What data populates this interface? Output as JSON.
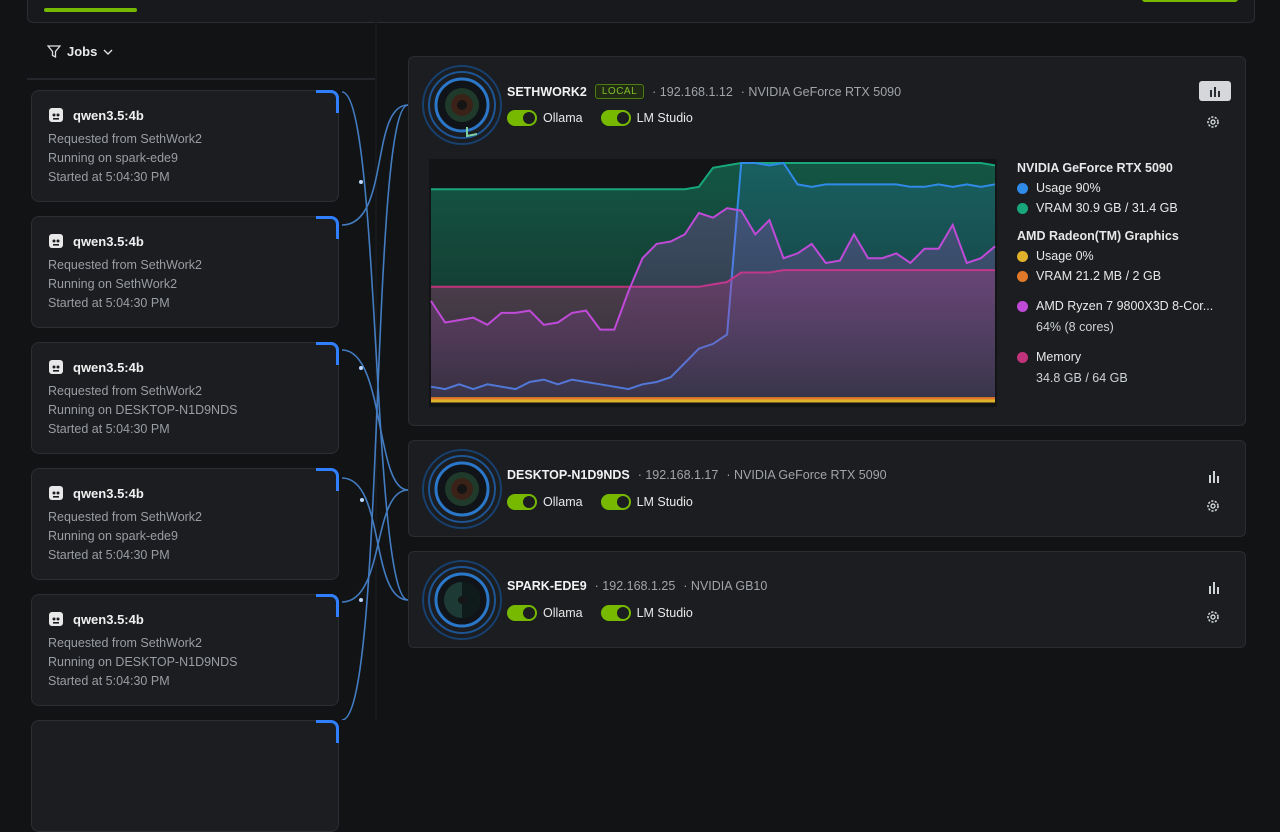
{
  "jobs_filter": {
    "label": "Jobs",
    "icon": "filter-icon"
  },
  "jobs": [
    {
      "model": "qwen3.5:4b",
      "requested": "Requested from SethWork2",
      "running": "Running on spark-ede9",
      "started": "Started at 5:04:30 PM"
    },
    {
      "model": "qwen3.5:4b",
      "requested": "Requested from SethWork2",
      "running": "Running on SethWork2",
      "started": "Started at 5:04:30 PM"
    },
    {
      "model": "qwen3.5:4b",
      "requested": "Requested from SethWork2",
      "running": "Running on DESKTOP-N1D9NDS",
      "started": "Started at 5:04:30 PM"
    },
    {
      "model": "qwen3.5:4b",
      "requested": "Requested from SethWork2",
      "running": "Running on spark-ede9",
      "started": "Started at 5:04:30 PM"
    },
    {
      "model": "qwen3.5:4b",
      "requested": "Requested from SethWork2",
      "running": "Running on DESKTOP-N1D9NDS",
      "started": "Started at 5:04:30 PM"
    }
  ],
  "machines": [
    {
      "name": "SETHWORK2",
      "badge": "LOCAL",
      "ip": "· 192.168.1.12",
      "gpu": "· NVIDIA GeForce RTX 5090",
      "toggles": [
        {
          "label": "Ollama",
          "on": true
        },
        {
          "label": "LM Studio",
          "on": true
        }
      ]
    },
    {
      "name": "DESKTOP-N1D9NDS",
      "ip": "· 192.168.1.17",
      "gpu": "· NVIDIA GeForce RTX 5090",
      "toggles": [
        {
          "label": "Ollama",
          "on": true
        },
        {
          "label": "LM Studio",
          "on": true
        }
      ]
    },
    {
      "name": "SPARK-EDE9",
      "ip": "· 192.168.1.25",
      "gpu": "· NVIDIA GB10",
      "toggles": [
        {
          "label": "Ollama",
          "on": true
        },
        {
          "label": "LM Studio",
          "on": true
        }
      ]
    }
  ],
  "legend": {
    "nvidia_title": "NVIDIA GeForce RTX 5090",
    "nvidia_usage": "Usage  90%",
    "nvidia_vram": "VRAM  30.9 GB / 31.4 GB",
    "amd_title": "AMD Radeon(TM) Graphics",
    "amd_usage": "Usage  0%",
    "amd_vram": "VRAM  21.2 MB / 2 GB",
    "cpu_title": "AMD Ryzen 7 9800X3D 8-Cor...",
    "cpu_sub": "64% (8 cores)",
    "mem_title": "Memory",
    "mem_sub": "34.8 GB / 64 GB"
  },
  "colors": {
    "accent": "#76b900",
    "gpu_usage": "#2f8ae8",
    "vram": "#17a77b",
    "amd_usage": "#e0b12a",
    "amd_vram": "#e07a2a",
    "cpu": "#c04ad8",
    "memory": "#c0337a"
  },
  "chart_data": {
    "type": "area",
    "x": [
      0,
      1,
      2,
      3,
      4,
      5,
      6,
      7,
      8,
      9,
      10,
      11,
      12,
      13,
      14,
      15,
      16,
      17,
      18,
      19,
      20,
      21,
      22,
      23,
      24,
      25,
      26,
      27,
      28,
      29,
      30,
      31,
      32,
      33,
      34,
      35,
      36,
      37,
      38,
      39,
      40
    ],
    "series": [
      {
        "key": "vram",
        "values": [
          89,
          89,
          89,
          89,
          89,
          89,
          89,
          89,
          89,
          89,
          89,
          89,
          89,
          89,
          89,
          89,
          89,
          89,
          89,
          90,
          98,
          99,
          100,
          100,
          100,
          100,
          100,
          100,
          100,
          100,
          100,
          100,
          100,
          100,
          100,
          100,
          100,
          100,
          100,
          100,
          99
        ]
      },
      {
        "key": "gpu_usage",
        "values": [
          6,
          5,
          7,
          5,
          7,
          6,
          5,
          8,
          9,
          7,
          9,
          8,
          7,
          6,
          5,
          7,
          8,
          10,
          16,
          22,
          24,
          28,
          100,
          100,
          99,
          100,
          91,
          90,
          91,
          91,
          91,
          91,
          91,
          91,
          90,
          90,
          91,
          90,
          91,
          90,
          91
        ]
      },
      {
        "key": "memory",
        "values": [
          48,
          48,
          48,
          48,
          48,
          48,
          48,
          48,
          48,
          48,
          48,
          48,
          48,
          48,
          48,
          48,
          48,
          48,
          48,
          48,
          49,
          50,
          54,
          54,
          54,
          55,
          55,
          55,
          55,
          55,
          55,
          55,
          55,
          55,
          55,
          55,
          55,
          55,
          55,
          55,
          55
        ]
      },
      {
        "key": "cpu",
        "values": [
          42,
          33,
          34,
          35,
          32,
          37,
          37,
          38,
          32,
          33,
          37,
          38,
          30,
          30,
          46,
          60,
          66,
          67,
          70,
          79,
          77,
          81,
          80,
          70,
          76,
          60,
          62,
          66,
          58,
          59,
          70,
          60,
          60,
          62,
          58,
          64,
          64,
          74,
          58,
          60,
          65
        ]
      },
      {
        "key": "amd_vram",
        "values": [
          1,
          1,
          1,
          1,
          1,
          1,
          1,
          1,
          1,
          1,
          1,
          1,
          1,
          1,
          1,
          1,
          1,
          1,
          1,
          1,
          1,
          1,
          1,
          1,
          1,
          1,
          1,
          1,
          1,
          1,
          1,
          1,
          1,
          1,
          1,
          1,
          1,
          1,
          1,
          1,
          1
        ]
      },
      {
        "key": "amd_usage",
        "values": [
          0,
          0,
          0,
          0,
          0,
          0,
          0,
          0,
          0,
          0,
          0,
          0,
          0,
          0,
          0,
          0,
          0,
          0,
          0,
          0,
          0,
          0,
          0,
          0,
          0,
          0,
          0,
          0,
          0,
          0,
          0,
          0,
          0,
          0,
          0,
          0,
          0,
          0,
          0,
          0,
          0
        ]
      }
    ],
    "ylim": [
      0,
      100
    ]
  }
}
